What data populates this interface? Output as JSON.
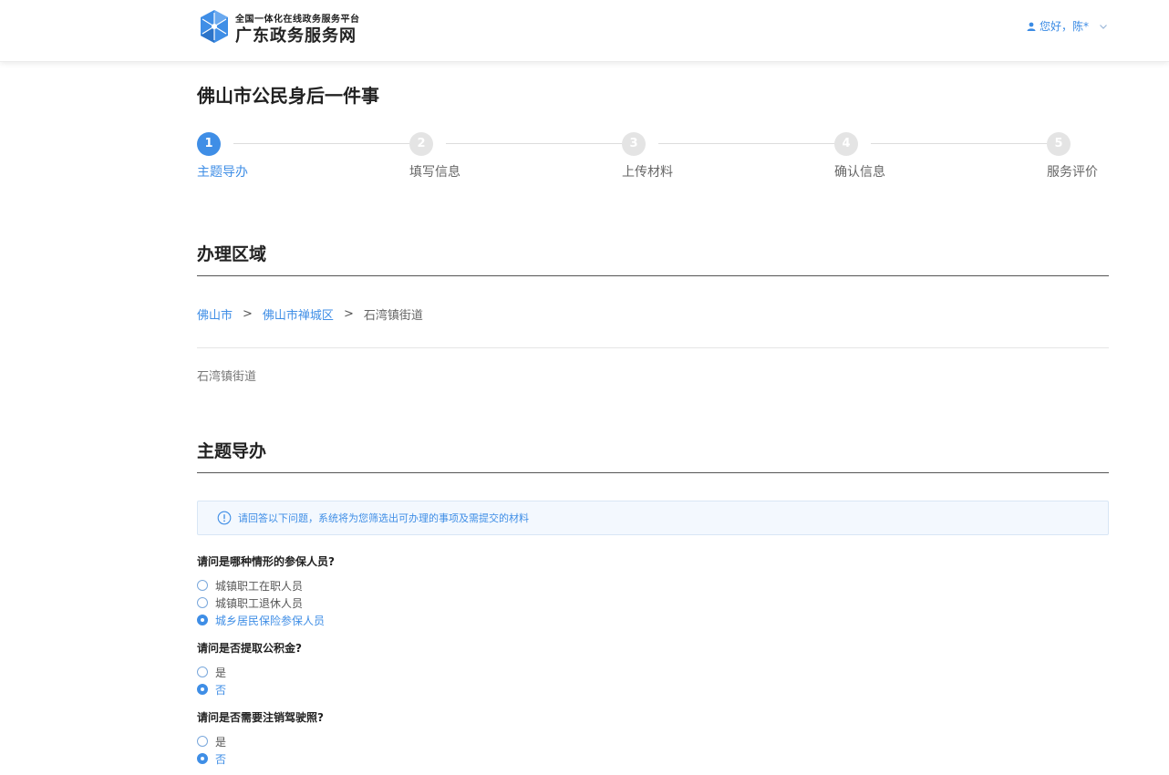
{
  "header": {
    "platform_subtitle": "全国一体化在线政务服务平台",
    "site_name": "广东政务服务网",
    "user_greeting": "您好，陈*",
    "brand_color": "#3f8ee6"
  },
  "page_title": "佛山市公民身后一件事",
  "steps": [
    {
      "number": "1",
      "label": "主题导办",
      "active": true
    },
    {
      "number": "2",
      "label": "填写信息",
      "active": false
    },
    {
      "number": "3",
      "label": "上传材料",
      "active": false
    },
    {
      "number": "4",
      "label": "确认信息",
      "active": false
    },
    {
      "number": "5",
      "label": "服务评价",
      "active": false
    }
  ],
  "region": {
    "title": "办理区域",
    "breadcrumb": [
      "佛山市",
      "佛山市禅城区",
      "石湾镇街道"
    ],
    "separator": ">",
    "selected": "石湾镇街道"
  },
  "guide": {
    "title": "主题导办",
    "notice": "请回答以下问题，系统将为您筛选出可办理的事项及需提交的材料",
    "questions": [
      {
        "text": "请问是哪种情形的参保人员?",
        "options": [
          {
            "label": "城镇职工在职人员",
            "checked": false
          },
          {
            "label": "城镇职工退休人员",
            "checked": false
          },
          {
            "label": "城乡居民保险参保人员",
            "checked": true
          }
        ]
      },
      {
        "text": "请问是否提取公积金?",
        "options": [
          {
            "label": "是",
            "checked": false
          },
          {
            "label": "否",
            "checked": true
          }
        ]
      },
      {
        "text": "请问是否需要注销驾驶照?",
        "options": [
          {
            "label": "是",
            "checked": false
          },
          {
            "label": "否",
            "checked": true
          }
        ]
      }
    ]
  }
}
